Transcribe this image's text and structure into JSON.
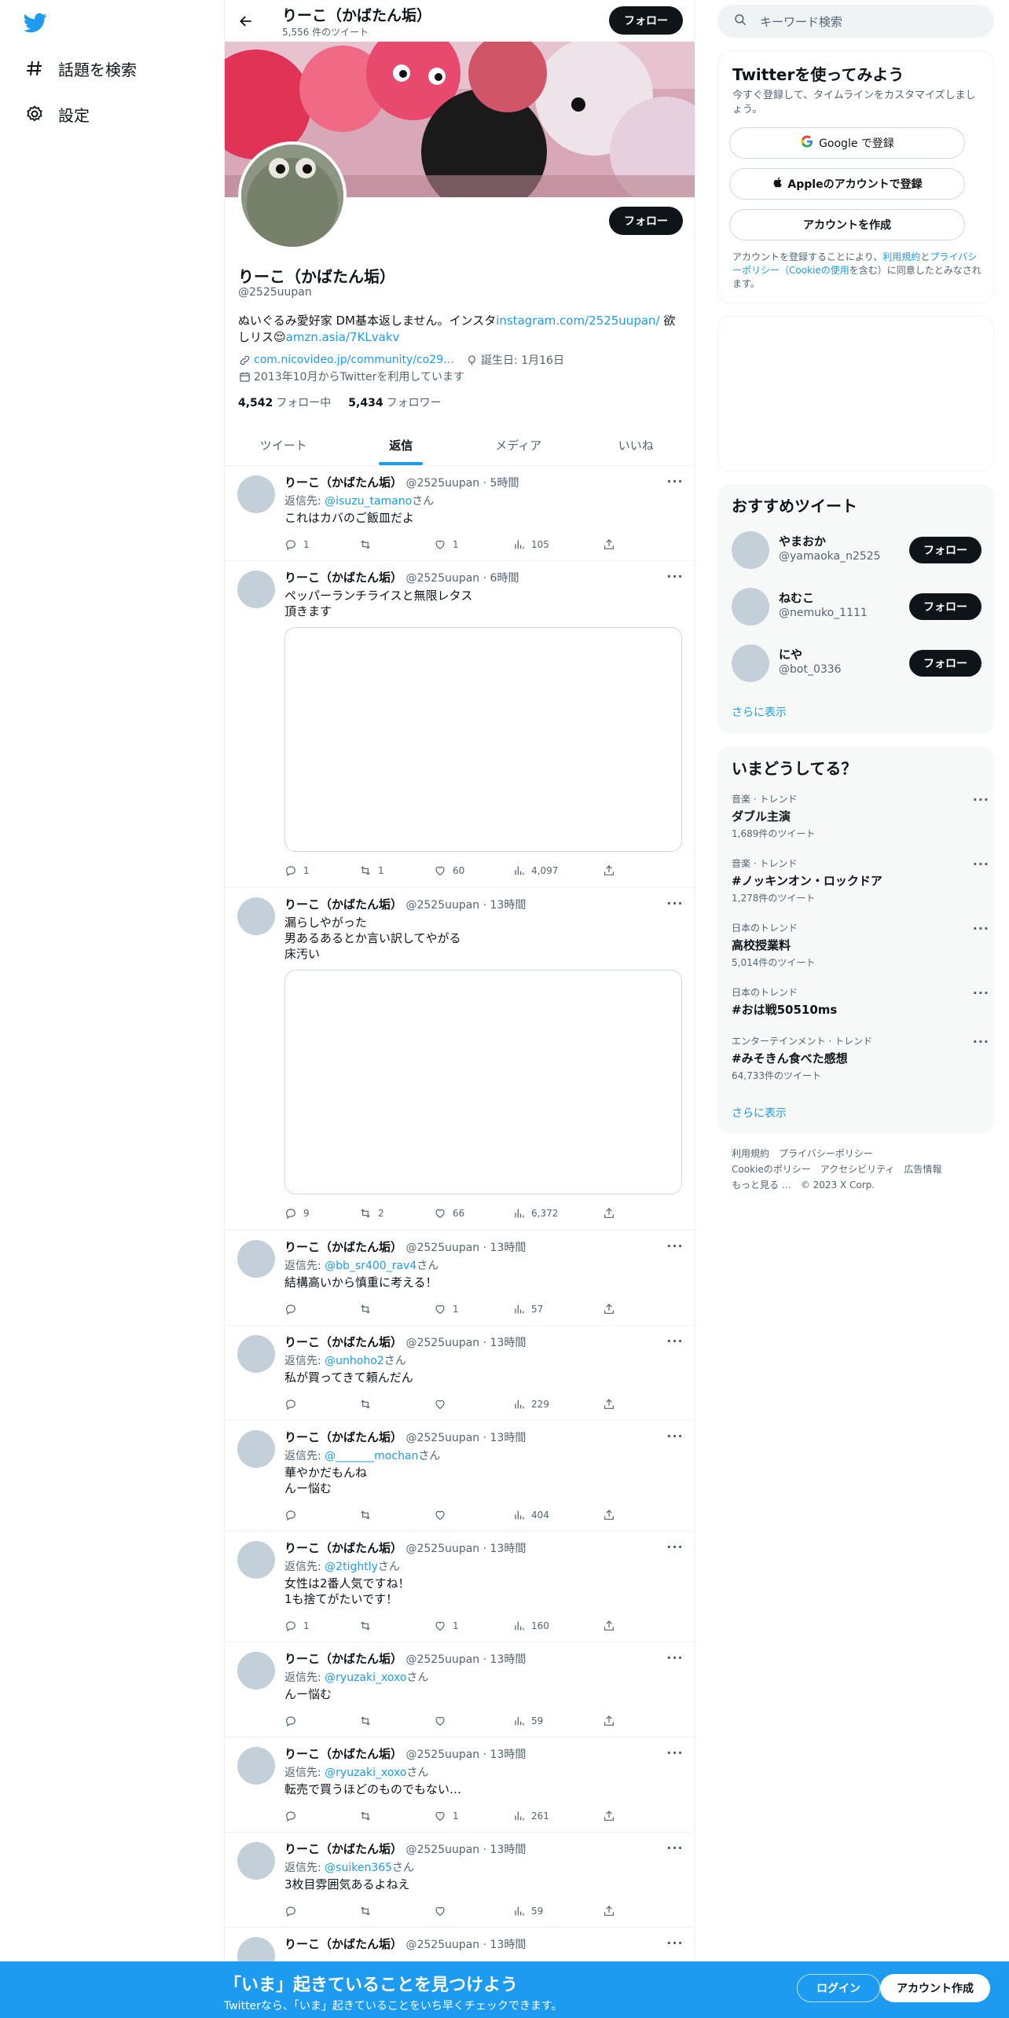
{
  "nav": {
    "items": [
      {
        "label": "話題を検索",
        "icon": "hashtag-icon"
      },
      {
        "label": "設定",
        "icon": "gear-icon"
      }
    ]
  },
  "header": {
    "name": "りーこ（かばたん垢）",
    "tweet_count": "5,556 件のツイート",
    "follow": "フォロー"
  },
  "profile": {
    "name": "りーこ（かばたん垢）",
    "handle": "@2525uupan",
    "follow": "フォロー",
    "bio_prefix": "ぬいぐるみ愛好家 DM基本返しません。インスタ",
    "bio_link": "instagram.com/2525uupan/",
    "bio_mid": " 欲しリス",
    "bio_link2": "amzn.asia/7KLvakv",
    "url": "com.nicovideo.jp/community/co29…",
    "birthday": "誕生日: 1月16日",
    "joined": "2013年10月からTwitterを利用しています",
    "following_count": "4,542",
    "following_label": "フォロー中",
    "followers_count": "5,434",
    "followers_label": "フォロワー"
  },
  "tabs": [
    {
      "label": "ツイート",
      "active": false
    },
    {
      "label": "返信",
      "active": true
    },
    {
      "label": "メディア",
      "active": false
    },
    {
      "label": "いいね",
      "active": false
    }
  ],
  "tweets": [
    {
      "name": "りーこ（かばたん垢）",
      "meta": "@2525uupan · 5時間",
      "reply_label": "返信先: ",
      "reply_to": "@isuzu_tamano",
      "reply_suffix": "さん",
      "text": "これはカバのご飯皿だよ",
      "replies": "1",
      "retweets": "",
      "likes": "1",
      "views": "105"
    },
    {
      "name": "りーこ（かばたん垢）",
      "meta": "@2525uupan · 6時間",
      "text": "ペッパーランチライスと無限レタス\n頂きます",
      "replies": "1",
      "retweets": "1",
      "likes": "60",
      "views": "4,097"
    },
    {
      "name": "りーこ（かばたん垢）",
      "meta": "@2525uupan · 13時間",
      "text": "漏らしやがった\n男あるあるとか言い訳してやがる\n床汚い",
      "replies": "9",
      "retweets": "2",
      "likes": "66",
      "views": "6,372"
    },
    {
      "name": "りーこ（かばたん垢）",
      "meta": "@2525uupan · 13時間",
      "reply_label": "返信先: ",
      "reply_to": "@bb_sr400_rav4",
      "reply_suffix": "さん",
      "text": "結構高いから慎重に考える！",
      "replies": "",
      "retweets": "",
      "likes": "1",
      "views": "57"
    },
    {
      "name": "りーこ（かばたん垢）",
      "meta": "@2525uupan · 13時間",
      "reply_label": "返信先: ",
      "reply_to": "@unhoho2",
      "reply_suffix": "さん",
      "text": "私が買ってきて頼んだん",
      "replies": "",
      "retweets": "",
      "likes": "",
      "views": "229"
    },
    {
      "name": "りーこ（かばたん垢）",
      "meta": "@2525uupan · 13時間",
      "reply_label": "返信先: ",
      "reply_to": "@_______mochan",
      "reply_suffix": "さん",
      "text": "華やかだもんね\nんー悩む",
      "replies": "",
      "retweets": "",
      "likes": "",
      "views": "404"
    },
    {
      "name": "りーこ（かばたん垢）",
      "meta": "@2525uupan · 13時間",
      "reply_label": "返信先: ",
      "reply_to": "@2tightly",
      "reply_suffix": "さん",
      "text": "女性は2番人気ですね！\n1も捨てがたいです！",
      "replies": "1",
      "retweets": "",
      "likes": "1",
      "views": "160"
    },
    {
      "name": "りーこ（かばたん垢）",
      "meta": "@2525uupan · 13時間",
      "reply_label": "返信先: ",
      "reply_to": "@ryuzaki_xoxo",
      "reply_suffix": "さん",
      "text": "んー悩む",
      "replies": "",
      "retweets": "",
      "likes": "",
      "views": "59"
    },
    {
      "name": "りーこ（かばたん垢）",
      "meta": "@2525uupan · 13時間",
      "reply_label": "返信先: ",
      "reply_to": "@ryuzaki_xoxo",
      "reply_suffix": "さん",
      "text": "転売で買うほどのものでもない…",
      "replies": "",
      "retweets": "",
      "likes": "1",
      "views": "261"
    },
    {
      "name": "りーこ（かばたん垢）",
      "meta": "@2525uupan · 13時間",
      "reply_label": "返信先: ",
      "reply_to": "@suiken365",
      "reply_suffix": "さん",
      "text": "3枚目雰囲気あるよねえ",
      "replies": "",
      "retweets": "",
      "likes": "",
      "views": "59"
    },
    {
      "name": "りーこ（かばたん垢）",
      "meta": "@2525uupan · 13時間"
    }
  ],
  "search": {
    "placeholder": "キーワード検索"
  },
  "signup": {
    "title": "Twitterを使ってみよう",
    "subtitle": "今すぐ登録して、タイムラインをカスタマイズしましょう。",
    "google": "Google で登録",
    "apple": "Appleのアカウントで登録",
    "create": "アカウントを作成",
    "terms_1": "アカウントを登録することにより、",
    "terms_link1": "利用規約",
    "terms_2": "と",
    "terms_link2": "プライバシーポリシー（Cookieの使用",
    "terms_3": "を含む）に同意したとみなされます。"
  },
  "recommend": {
    "title": "おすすめツイート",
    "users": [
      {
        "name": "やまおか",
        "handle": "@yamaoka_n2525",
        "button": "フォロー"
      },
      {
        "name": "ねむこ",
        "handle": "@nemuko_1111",
        "button": "フォロー"
      },
      {
        "name": "にや",
        "handle": "@bot_0336",
        "button": "フォロー"
      }
    ],
    "more": "さらに表示"
  },
  "trends": {
    "title": "いまどうしてる？",
    "items": [
      {
        "category": "音楽 · トレンド",
        "topic": "ダブル主演",
        "count": "1,689件のツイート"
      },
      {
        "category": "音楽 · トレンド",
        "topic": "#ノッキンオン・ロックドア",
        "count": "1,278件のツイート"
      },
      {
        "category": "日本のトレンド",
        "topic": "高校授業料",
        "count": "5,014件のツイート"
      },
      {
        "category": "日本のトレンド",
        "topic": "#おは戦50510ms",
        "count": ""
      },
      {
        "category": "エンターテインメント · トレンド",
        "topic": "#みそきん食べた感想",
        "count": "64,733件のツイート"
      }
    ],
    "more": "さらに表示"
  },
  "footer": {
    "links": [
      "利用規約",
      "プライバシーポリシー",
      "Cookieのポリシー",
      "アクセシビリティ",
      "広告情報",
      "もっと見る …",
      "© 2023 X Corp."
    ]
  },
  "bottom": {
    "title": "「いま」起きていることを見つけよう",
    "subtitle": "Twitterなら、「いま」起きていることをいち早くチェックできます。",
    "login": "ログイン",
    "signup": "アカウント作成"
  },
  "colors": {
    "accent": "#1d9bf0",
    "text": "#0f1419",
    "muted": "#536471"
  }
}
